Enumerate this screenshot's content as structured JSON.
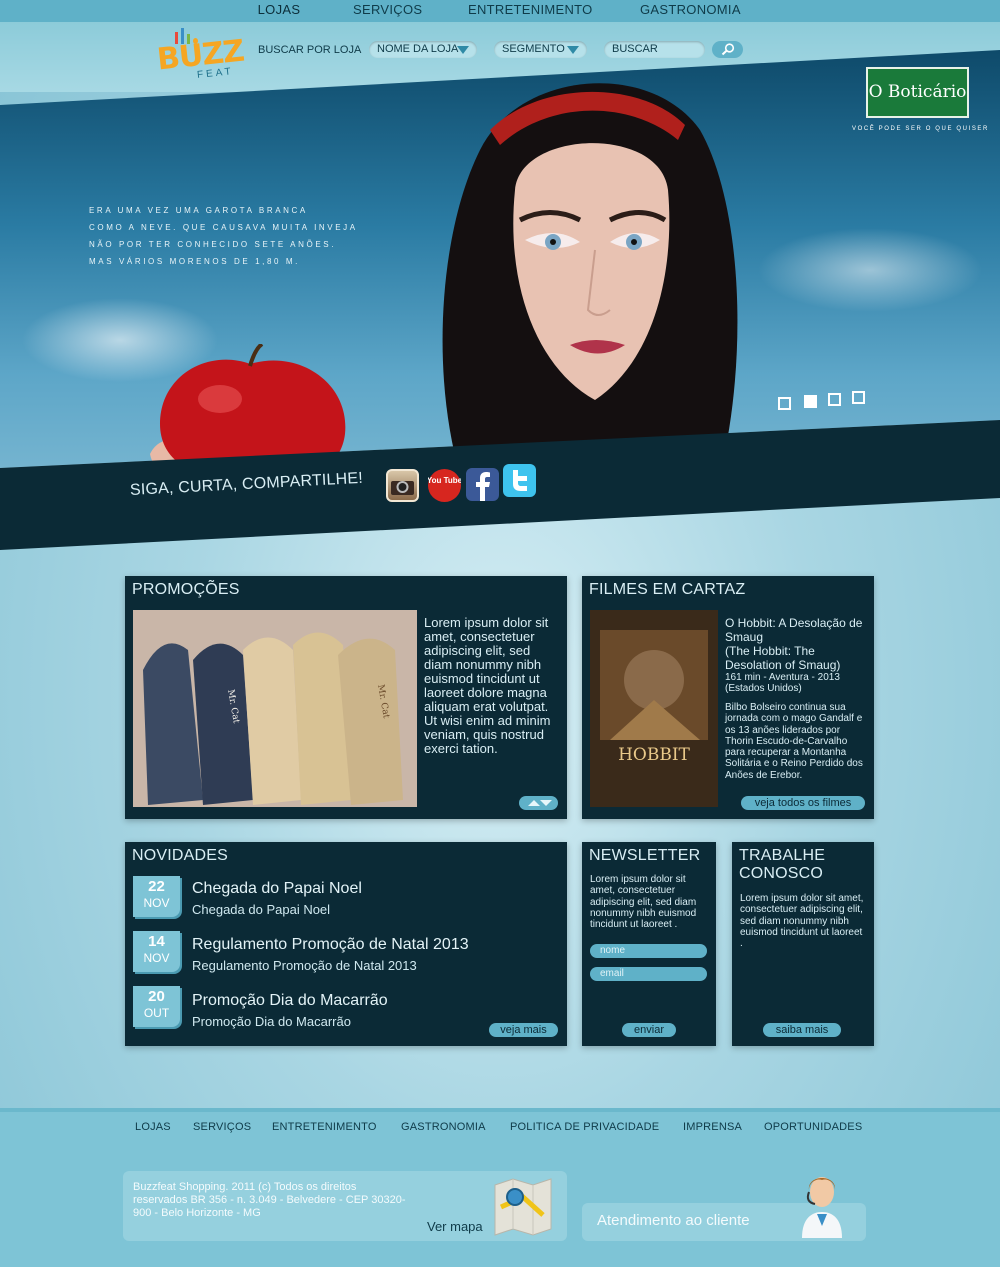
{
  "topnav": {
    "items": [
      "LOJAS",
      "SERVIÇOS",
      "ENTRETENIMENTO",
      "GASTRONOMIA"
    ],
    "active": "LOJAS"
  },
  "header": {
    "logo_main": "BUZZ",
    "logo_sub": "FEAT",
    "search_label": "BUSCAR POR LOJA",
    "store_name_select": "NOME DA LOJA",
    "segment_select": "SEGMENTO",
    "search_placeholder": "BUSCAR"
  },
  "hero": {
    "text_lines": [
      "Era uma vez uma garota branca",
      "como a neve. Que causava muita inveja",
      "não por ter conhecido sete anões.",
      "Mas vários morenos de 1,80 m."
    ],
    "brand": "O Boticário",
    "brand_tagline": "você pode ser o que quiser",
    "slides_total": 4,
    "slide_active": 2
  },
  "social": {
    "label": "SIGA, CURTA, COMPARTILHE!",
    "icons": [
      "instagram-icon",
      "youtube-icon",
      "facebook-icon",
      "twitter-icon"
    ],
    "youtube_text": "You Tube"
  },
  "promocoes": {
    "title": "PROMOÇÕES",
    "image_label": "Mr. Cat",
    "text": "Lorem ipsum dolor sit amet, consectetuer adipiscing elit, sed diam nonummy nibh euismod tincidunt ut laoreet dolore magna aliquam erat volutpat. Ut wisi enim ad minim veniam, quis nostrud exerci tation."
  },
  "filmes": {
    "title": "FILMES EM CARTAZ",
    "poster_title": "HOBBIT",
    "movie_title": "O Hobbit: A Desolação de Smaug",
    "movie_original": "(The Hobbit: The Desolation of Smaug)",
    "meta": "161 min - Aventura - 2013 (Estados Unidos)",
    "synopsis": "Bilbo Bolseiro continua sua jornada com o mago Gandalf e os 13 anões liderados por Thorin Escudo-de-Carvalho para recuperar a Montanha Solitária e o Reino Perdido dos Anões de Erebor.",
    "button": "veja todos os filmes"
  },
  "novidades": {
    "title": "NOVIDADES",
    "items": [
      {
        "day": "22",
        "month": "NOV",
        "title": "Chegada do Papai Noel",
        "subtitle": "Chegada do Papai Noel"
      },
      {
        "day": "14",
        "month": "NOV",
        "title": "Regulamento Promoção de Natal 2013",
        "subtitle": "Regulamento Promoção de Natal 2013"
      },
      {
        "day": "20",
        "month": "OUT",
        "title": "Promoção Dia do Macarrão",
        "subtitle": "Promoção Dia do Macarrão"
      }
    ],
    "button": "veja mais"
  },
  "newsletter": {
    "title": "NEWSLETTER",
    "text": "Lorem ipsum dolor sit amet, consectetuer adipiscing elit, sed diam nonummy nibh euismod tincidunt ut laoreet .",
    "name_placeholder": "nome",
    "email_placeholder": "email",
    "button": "enviar"
  },
  "trabalhe": {
    "title_line1": "TRABALHE",
    "title_line2": "CONOSCO",
    "text": "Lorem ipsum dolor sit amet, consectetuer adipiscing elit, sed diam nonummy nibh euismod tincidunt ut laoreet .",
    "button": "saiba mais"
  },
  "footer": {
    "nav": [
      "LOJAS",
      "SERVIÇOS",
      "ENTRETENIMENTO",
      "GASTRONOMIA",
      "POLITICA DE PRIVACIDADE",
      "IMPRENSA",
      "OPORTUNIDADES"
    ],
    "address": "Buzzfeat Shopping. 2011 (c) Todos os direitos reservados BR 356 - n. 3.049 - Belvedere - CEP 30320-900 - Belo Horizonte - MG",
    "map_link": "Ver mapa",
    "customer_service": "Atendimento ao cliente"
  },
  "colors": {
    "accent": "#5fb1c8",
    "panel": "#0b2a36",
    "logo_orange": "#f5a623"
  }
}
